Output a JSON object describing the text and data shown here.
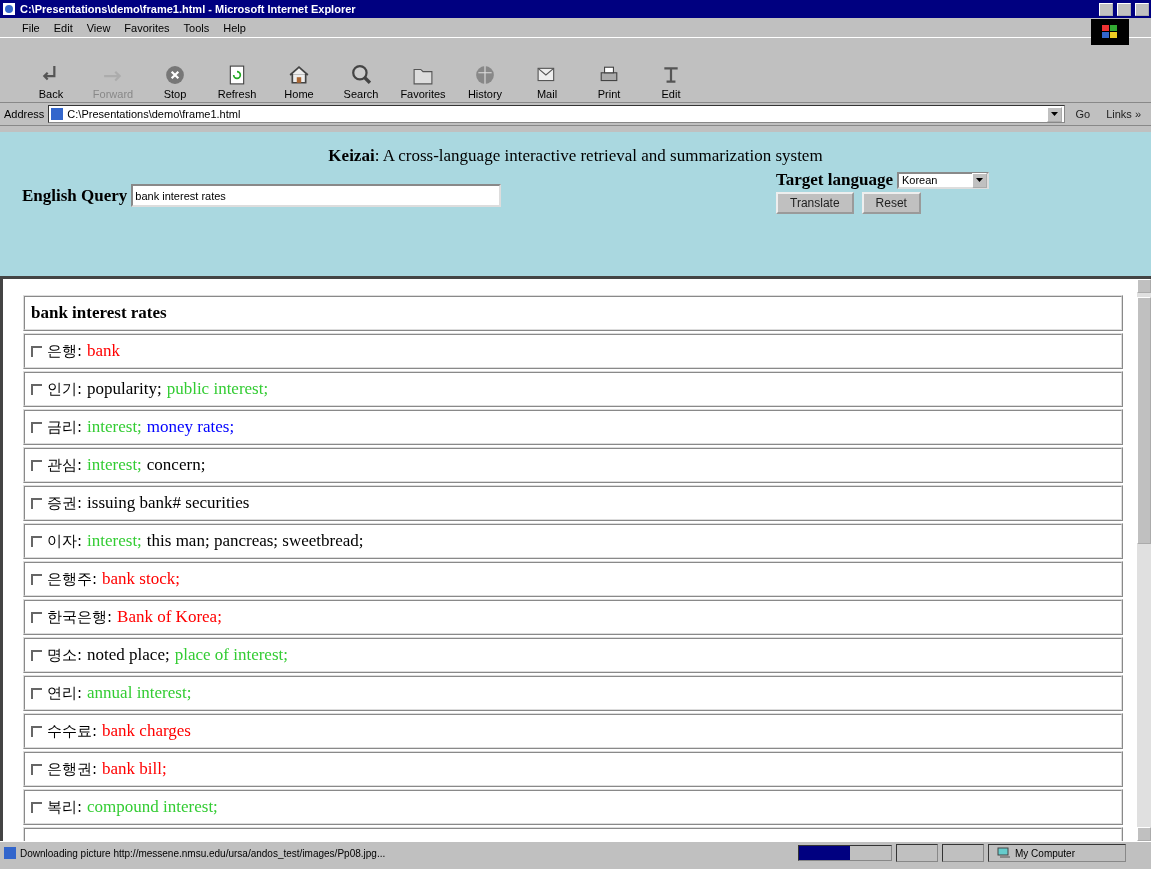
{
  "window": {
    "title": "C:\\Presentations\\demo\\frame1.html - Microsoft Internet Explorer"
  },
  "menu": [
    "File",
    "Edit",
    "View",
    "Favorites",
    "Tools",
    "Help"
  ],
  "toolbar": [
    {
      "label": "Back",
      "disabled": false
    },
    {
      "label": "Forward",
      "disabled": true
    },
    {
      "label": "Stop",
      "disabled": false
    },
    {
      "label": "Refresh",
      "disabled": false
    },
    {
      "label": "Home",
      "disabled": false
    },
    {
      "label": "Search",
      "disabled": false
    },
    {
      "label": "Favorites",
      "disabled": false
    },
    {
      "label": "History",
      "disabled": false
    },
    {
      "label": "Mail",
      "disabled": false
    },
    {
      "label": "Print",
      "disabled": false
    },
    {
      "label": "Edit",
      "disabled": false
    }
  ],
  "address_bar": {
    "label": "Address",
    "value": "C:\\Presentations\\demo\\frame1.html",
    "go": "Go",
    "links": "Links »"
  },
  "query_panel": {
    "title": "**Keizai**: A cross-language interactive retrieval and summarization system",
    "query_label": "English Query",
    "query_value": "bank interest rates",
    "target_label": "Target language",
    "target_value": "Korean",
    "buttons": [
      "Translate",
      "Reset"
    ]
  },
  "results": {
    "heading": "bank interest rates",
    "rows": [
      {
        "term": "은행:",
        "checked": false,
        "segments": [
          {
            "text": "bank",
            "color": "#ff0000"
          }
        ]
      },
      {
        "term": "인기:",
        "checked": false,
        "segments": [
          {
            "text": "popularity;",
            "color": "#000000"
          },
          {
            "text": "public interest;",
            "color": "#33cc33"
          }
        ]
      },
      {
        "term": "금리:",
        "checked": false,
        "segments": [
          {
            "text": "interest;",
            "color": "#33cc33"
          },
          {
            "text": "money rates;",
            "color": "#0000ff"
          }
        ]
      },
      {
        "term": "관심:",
        "checked": false,
        "segments": [
          {
            "text": "interest;",
            "color": "#33cc33"
          },
          {
            "text": "concern;",
            "color": "#000000"
          }
        ]
      },
      {
        "term": "증권:",
        "checked": false,
        "segments": [
          {
            "text": "issuing bank# securities",
            "color": "#000000"
          }
        ]
      },
      {
        "term": "이자:",
        "checked": false,
        "segments": [
          {
            "text": "interest;",
            "color": "#33cc33"
          },
          {
            "text": "this man; pancreas; sweetbread;",
            "color": "#000000"
          }
        ]
      },
      {
        "term": "은행주:",
        "checked": false,
        "segments": [
          {
            "text": "bank stock;",
            "color": "#ff0000"
          }
        ]
      },
      {
        "term": "한국은행:",
        "checked": false,
        "segments": [
          {
            "text": "Bank of Korea;",
            "color": "#ff0000"
          }
        ]
      },
      {
        "term": "명소:",
        "checked": false,
        "segments": [
          {
            "text": "noted place;",
            "color": "#000000"
          },
          {
            "text": "place of interest;",
            "color": "#33cc33"
          }
        ]
      },
      {
        "term": "연리:",
        "checked": false,
        "segments": [
          {
            "text": "annual interest;",
            "color": "#33cc33"
          }
        ]
      },
      {
        "term": "수수료:",
        "checked": false,
        "segments": [
          {
            "text": "bank charges",
            "color": "#ff0000"
          }
        ]
      },
      {
        "term": "은행권:",
        "checked": false,
        "segments": [
          {
            "text": "bank bill;",
            "color": "#ff0000"
          }
        ]
      },
      {
        "term": "복리:",
        "checked": false,
        "segments": [
          {
            "text": "compound interest;",
            "color": "#33cc33"
          }
        ]
      }
    ]
  },
  "status_bar": {
    "message": "Downloading picture http://messene.nmsu.edu/ursa/andos_test/images/Pp08.jpg...",
    "level": 0.55,
    "zone": "My Computer"
  }
}
